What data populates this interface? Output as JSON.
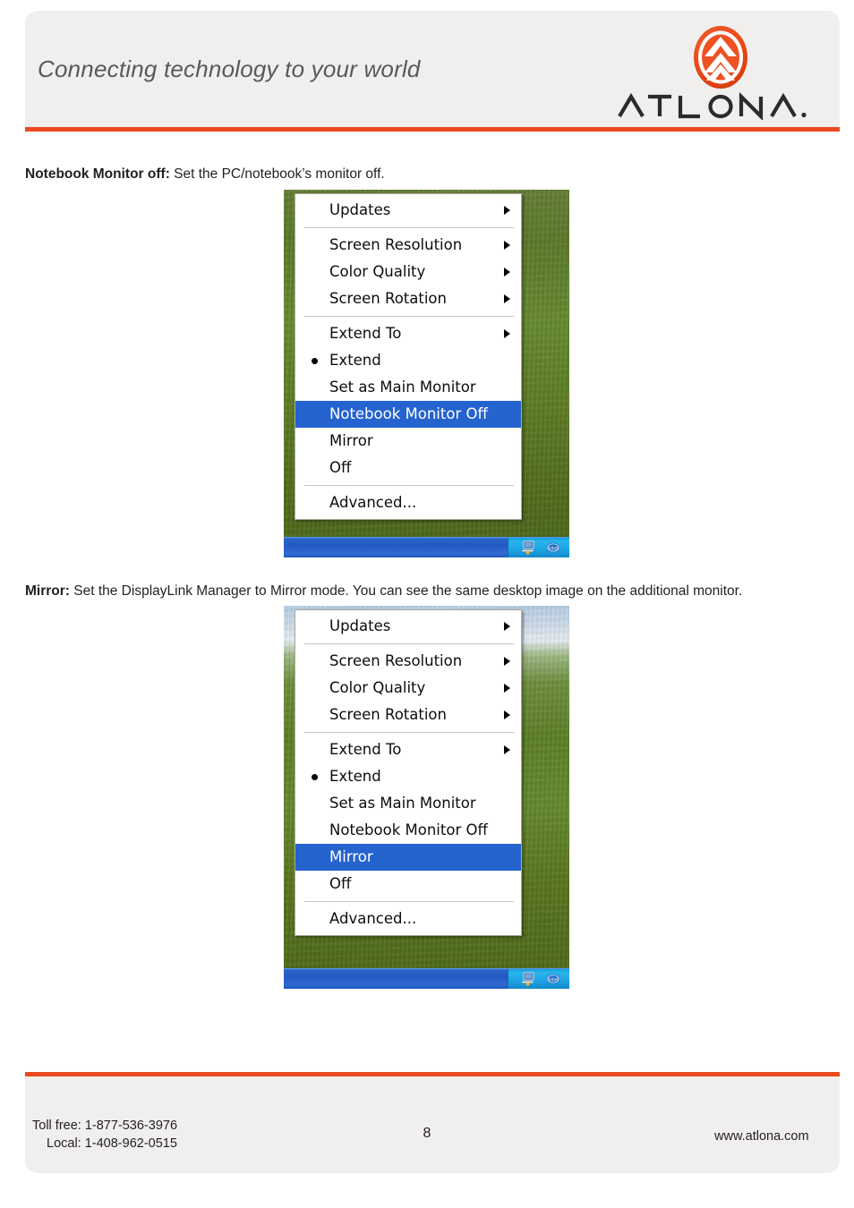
{
  "page": {
    "accent_color": "#eb4a1e",
    "band_color": "#f0efed",
    "page_number": "8"
  },
  "header": {
    "tagline": "Connecting technology to your world",
    "logo_wordmark": "ATLONA.",
    "logo_icon": "atlona-chevron-logo"
  },
  "content": {
    "sections": [
      {
        "term": "Notebook Monitor off:",
        "description": " Set the PC/notebook’s monitor off."
      },
      {
        "term": "Mirror:",
        "description": " Set the DisplayLink Manager to Mirror mode. You can see the same desktop image on the additional monitor."
      }
    ]
  },
  "screenshots": [
    {
      "name": "displaylink-menu-notebook-monitor-off",
      "selected_item": "Notebook Monitor Off",
      "radio_item": "Extend",
      "menu_items": [
        {
          "label": "Updates",
          "submenu": true,
          "separator_after": true
        },
        {
          "label": "Screen Resolution",
          "submenu": true
        },
        {
          "label": "Color Quality",
          "submenu": true
        },
        {
          "label": "Screen Rotation",
          "submenu": true,
          "separator_after": true
        },
        {
          "label": "Extend To",
          "submenu": true
        },
        {
          "label": "Extend",
          "radio": true
        },
        {
          "label": "Set as Main Monitor"
        },
        {
          "label": "Notebook Monitor Off",
          "selected": true
        },
        {
          "label": "Mirror"
        },
        {
          "label": "Off",
          "separator_after": true
        },
        {
          "label": "Advanced..."
        }
      ],
      "tray_icons": [
        "displaylink-monitor-icon",
        "intel-logo-icon"
      ]
    },
    {
      "name": "displaylink-menu-mirror",
      "selected_item": "Mirror",
      "radio_item": "Extend",
      "menu_items": [
        {
          "label": "Updates",
          "submenu": true,
          "separator_after": true
        },
        {
          "label": "Screen Resolution",
          "submenu": true
        },
        {
          "label": "Color Quality",
          "submenu": true
        },
        {
          "label": "Screen Rotation",
          "submenu": true,
          "separator_after": true
        },
        {
          "label": "Extend To",
          "submenu": true
        },
        {
          "label": "Extend",
          "radio": true
        },
        {
          "label": "Set as Main Monitor"
        },
        {
          "label": "Notebook Monitor Off"
        },
        {
          "label": "Mirror",
          "selected": true
        },
        {
          "label": "Off",
          "separator_after": true
        },
        {
          "label": "Advanced..."
        }
      ],
      "tray_icons": [
        "displaylink-monitor-icon",
        "intel-logo-icon"
      ]
    }
  ],
  "footer": {
    "toll_free": "Toll free: 1-877-536-3976",
    "local": "Local: 1-408-962-0515",
    "page_number": "8",
    "website": "www.atlona.com"
  }
}
